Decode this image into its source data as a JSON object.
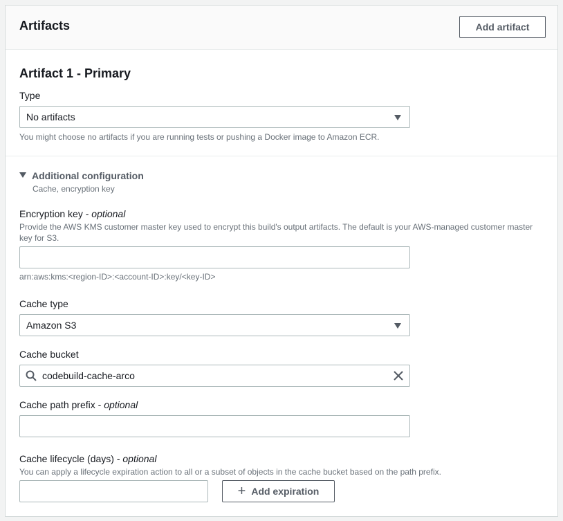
{
  "header": {
    "title": "Artifacts",
    "add_button": "Add artifact"
  },
  "artifact": {
    "title": "Artifact 1 - Primary",
    "type_label": "Type",
    "type_value": "No artifacts",
    "type_help": "You might choose no artifacts if you are running tests or pushing a Docker image to Amazon ECR."
  },
  "additional": {
    "title": "Additional configuration",
    "subtitle": "Cache, encryption key"
  },
  "encryption": {
    "label": "Encryption key",
    "optional": "optional",
    "help": "Provide the AWS KMS customer master key used to encrypt this build's output artifacts. The default is your AWS-managed customer master key for S3.",
    "value": "",
    "hint": "arn:aws:kms:<region-ID>:<account-ID>:key/<key-ID>"
  },
  "cache_type": {
    "label": "Cache type",
    "value": "Amazon S3"
  },
  "cache_bucket": {
    "label": "Cache bucket",
    "value": "codebuild-cache-arco"
  },
  "cache_path": {
    "label": "Cache path prefix",
    "optional": "optional",
    "value": ""
  },
  "cache_lifecycle": {
    "label": "Cache lifecycle (days)",
    "optional": "optional",
    "help": "You can apply a lifecycle expiration action to all or a subset of objects in the cache bucket based on the path prefix.",
    "value": "",
    "add_button": "Add expiration"
  },
  "icons": [
    "search-icon",
    "clear-icon",
    "caret-down-icon",
    "plus-icon"
  ],
  "colors": {
    "border": "#aab7b8",
    "text": "#16191f",
    "muted": "#687078",
    "button": "#545b64"
  }
}
